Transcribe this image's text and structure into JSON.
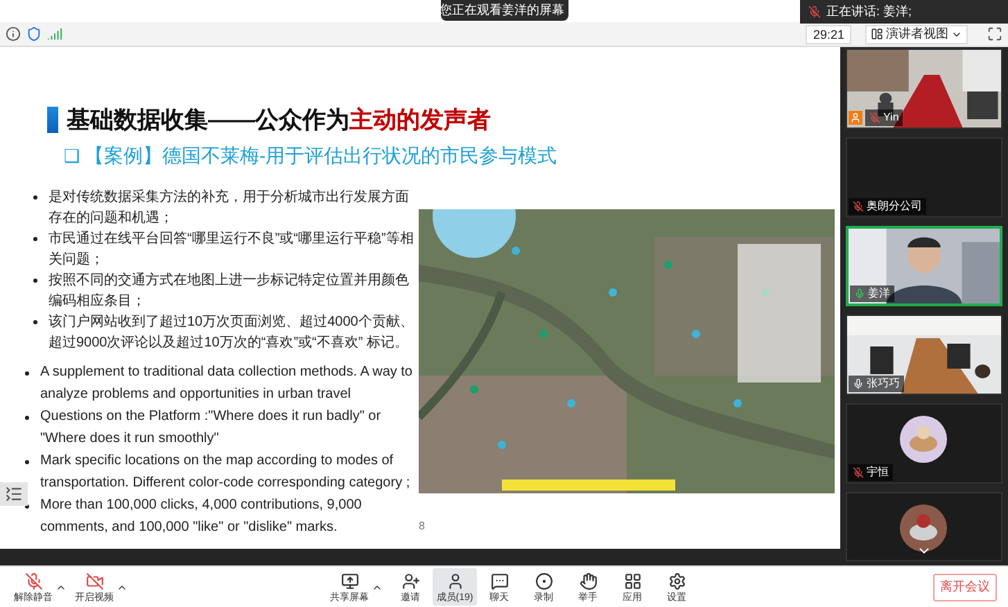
{
  "notice": {
    "text": "您正在观看姜洋的屏幕"
  },
  "speaking": {
    "text": "正在讲话: 姜洋;"
  },
  "timer": "29:21",
  "view_menu": {
    "label": "演讲者视图"
  },
  "slide": {
    "title": "基础数据收集——公众作为",
    "title_emphasis": "主动的发声者",
    "subtitle_mark": "❑",
    "subtitle": "【案例】德国不莱梅-用于评估出行状况的市民参与模式",
    "bullets_zh": [
      "是对传统数据采集方法的补充，用于分析城市出行发展方面存在的问题和机遇；",
      "市民通过在线平台回答“哪里运行不良”或“哪里运行平稳”等相关问题；",
      "按照不同的交通方式在地图上进一步标记特定位置并用颜色编码相应条目；",
      "该门户网站收到了超过10万次页面浏览、超过4000个贡献、超过9000次评论以及超过10万次的“喜欢”或“不喜欢” 标记。"
    ],
    "bullets_en": [
      "A supplement to traditional data collection methods. A way to analyze problems and opportunities in urban travel",
      "Questions on the Platform :\"Where does it run badly\" or \"Where does it run smoothly\"",
      "Mark specific locations on the map according to modes of transportation. Different color-code corresponding category ;",
      "More than 100,000 clicks, 4,000 contributions, 9,000 comments, and 100,000 \"like\" or \"dislike\" marks."
    ],
    "page": "8"
  },
  "participants": [
    {
      "name": "Yin",
      "kind": "room",
      "muted": true,
      "talking": false,
      "host": true,
      "speaking": false
    },
    {
      "name": "奥朗分公司",
      "kind": "blank",
      "muted": true,
      "talking": false,
      "host": false,
      "speaking": false
    },
    {
      "name": "姜洋",
      "kind": "person",
      "muted": false,
      "talking": true,
      "host": false,
      "speaking": true
    },
    {
      "name": "张巧巧",
      "kind": "meeting",
      "muted": false,
      "talking": false,
      "host": false,
      "speaking": false
    },
    {
      "name": "宇恒",
      "kind": "avatar",
      "muted": true,
      "talking": false,
      "host": false,
      "speaking": false
    },
    {
      "kind": "avatar2",
      "host": false,
      "speaking": false
    }
  ],
  "toolbar": [
    {
      "label": "解除静音",
      "kind": "mic",
      "caret": true,
      "selected": false
    },
    {
      "label": "开启视频",
      "kind": "video",
      "caret": true,
      "selected": false
    },
    {
      "label": "共享屏幕",
      "kind": "share",
      "caret": true,
      "selected": false
    },
    {
      "label": "邀请",
      "kind": "invite",
      "caret": false,
      "selected": false
    },
    {
      "label": "成员(19)",
      "kind": "members",
      "caret": false,
      "selected": true
    },
    {
      "label": "聊天",
      "kind": "chat",
      "caret": false,
      "selected": false
    },
    {
      "label": "录制",
      "kind": "record",
      "caret": false,
      "selected": false
    },
    {
      "label": "举手",
      "kind": "hand",
      "caret": false,
      "selected": false
    },
    {
      "label": "应用",
      "kind": "apps",
      "caret": false,
      "selected": false
    },
    {
      "label": "设置",
      "kind": "settings",
      "caret": false,
      "selected": false
    }
  ],
  "leave_button": "离开会议"
}
